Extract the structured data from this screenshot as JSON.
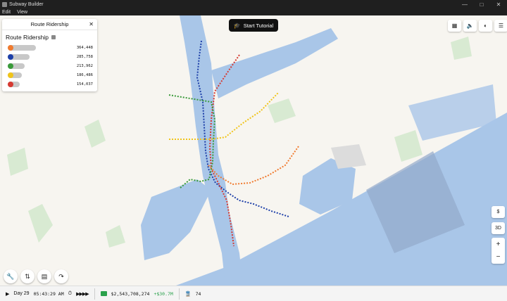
{
  "window": {
    "title": "Subway Builder",
    "controls": [
      "—",
      "□",
      "✕"
    ]
  },
  "menu": {
    "items": [
      "Edit",
      "View"
    ]
  },
  "tutorial": {
    "label": "Start Tutorial"
  },
  "ridership_panel": {
    "header": "Route Ridership",
    "close": "✕",
    "subtitle": "Route Ridership",
    "routes": [
      {
        "color": "#f07a2e",
        "bar_fraction": 1.0,
        "value": "364,448"
      },
      {
        "color": "#1d3fa8",
        "bar_fraction": 0.78,
        "value": "285,758"
      },
      {
        "color": "#3a9a3a",
        "bar_fraction": 0.59,
        "value": "213,962"
      },
      {
        "color": "#f0c419",
        "bar_fraction": 0.51,
        "value": "186,486"
      },
      {
        "color": "#d63a32",
        "bar_fraction": 0.42,
        "value": "154,037"
      }
    ]
  },
  "top_tools": {
    "map": "▦",
    "sound": "🔈",
    "palette": "◐",
    "menu": "☰"
  },
  "right_tools": {
    "currency": "$",
    "three_d": "3D",
    "zoom_in": "+",
    "zoom_out": "−"
  },
  "bottom_tools": [
    "🔧",
    "⇅",
    "▤",
    "↷"
  ],
  "status": {
    "play": "▶",
    "day": "Day 29",
    "time": "05:43:29 AM",
    "speed": "▶▶▶▶",
    "money": "$2,543,708,274",
    "money_delta": "+$30.7M",
    "trains": "74"
  },
  "colors": {
    "water": "#a9c6e8",
    "land": "#f7f5f0",
    "park": "#d8ead2"
  }
}
